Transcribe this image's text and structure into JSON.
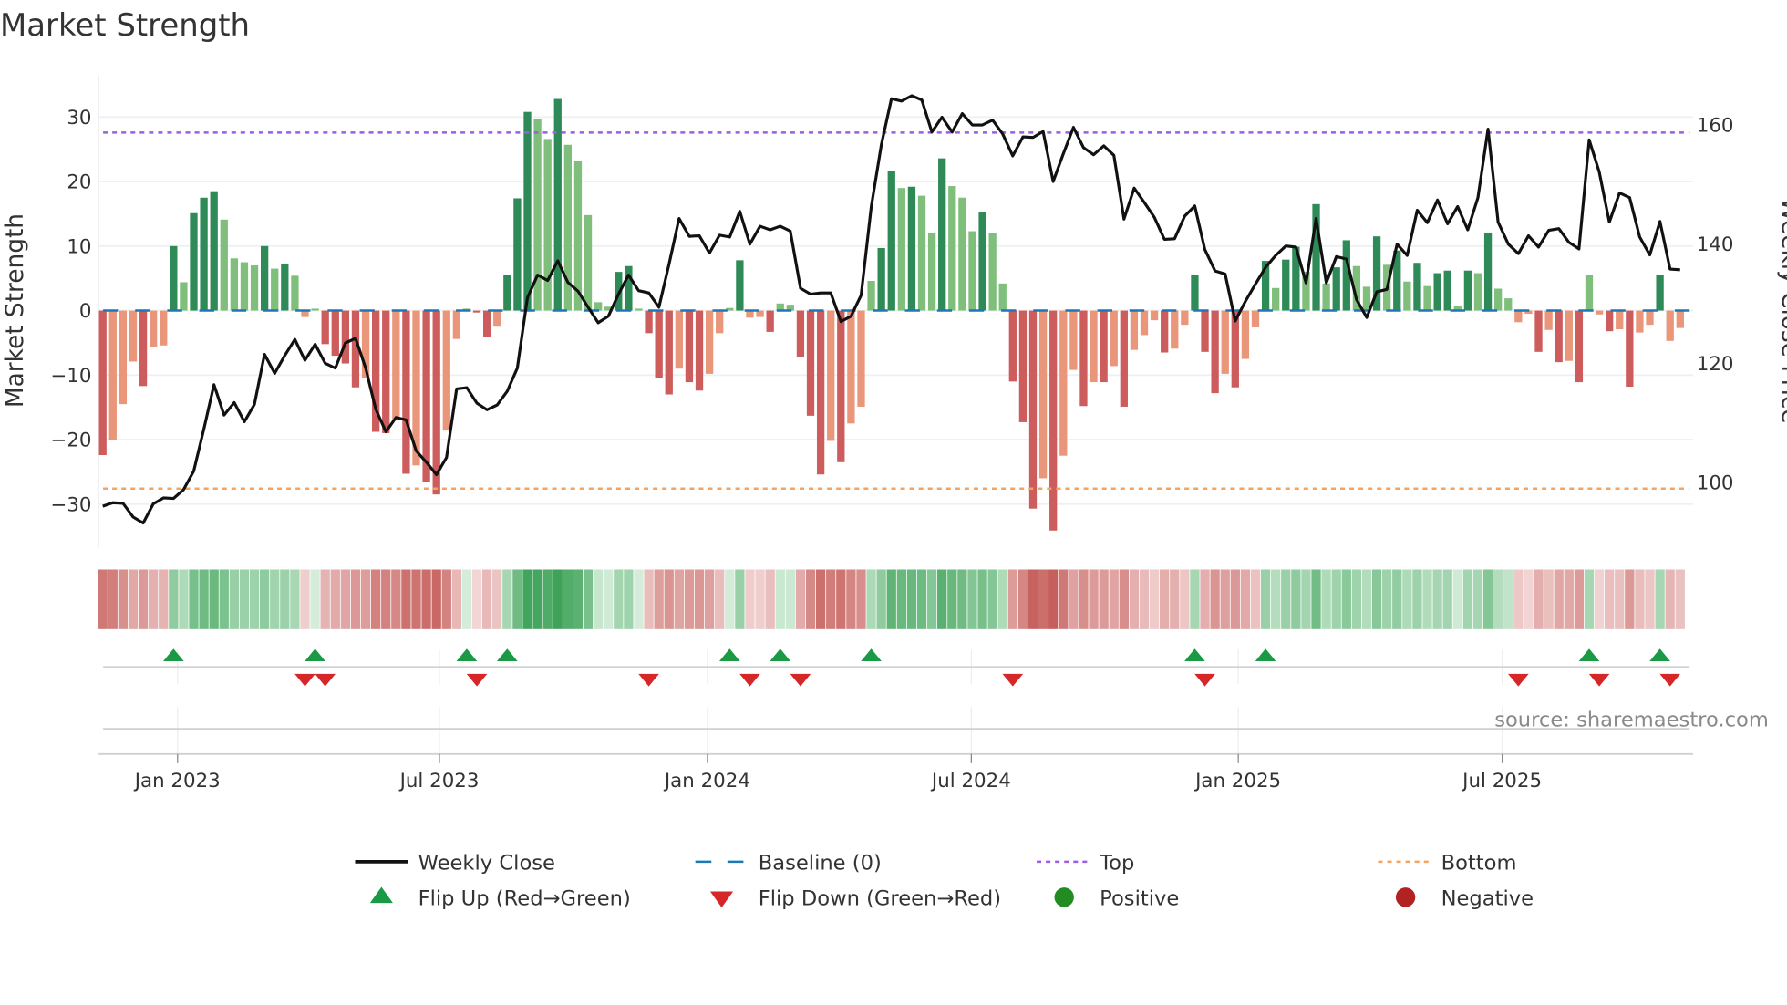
{
  "chart_data": {
    "type": "bar",
    "title": "Market Strength",
    "ylabel": "Market Strength",
    "y2label": "Weekly Close Price",
    "ylim": [
      -36.7,
      36.7
    ],
    "y2lim": [
      89,
      168.5
    ],
    "yticks": [
      30,
      20,
      10,
      0,
      -10,
      -20,
      -30
    ],
    "yticklabels": [
      "30",
      "20",
      "10",
      "0",
      "−10",
      "−20",
      "−30"
    ],
    "y2ticks": [
      160,
      140,
      120,
      100
    ],
    "y2ticklabels": [
      "160",
      "140",
      "120",
      "100"
    ],
    "top_level": 27.6,
    "bottom_level": -27.6,
    "baseline": 0,
    "grid": true,
    "xticks": [
      {
        "week": 7.4,
        "label": "Jan 2023"
      },
      {
        "week": 33.3,
        "label": "Jul 2023"
      },
      {
        "week": 59.8,
        "label": "Jan 2024"
      },
      {
        "week": 85.9,
        "label": "Jul 2024"
      },
      {
        "week": 112.3,
        "label": "Jan 2025"
      },
      {
        "week": 138.4,
        "label": "Jul 2025"
      }
    ],
    "series": [
      {
        "name": "Market Strength",
        "type": "bar",
        "values": [
          -22.4,
          -20,
          -14.5,
          -7.9,
          -11.7,
          -5.7,
          -5.4,
          10,
          4.4,
          15.1,
          17.5,
          18.5,
          14.1,
          8.1,
          7.5,
          7,
          10,
          6.5,
          7.3,
          5.4,
          -1,
          0.3,
          -5.2,
          -7,
          -8.2,
          -11.9,
          -10.5,
          -18.8,
          -19,
          -17,
          -25.3,
          -24,
          -26.5,
          -28.5,
          -18.6,
          -4.4,
          0.3,
          -0.3,
          -4.1,
          -2.5,
          5.5,
          17.4,
          30.8,
          29.7,
          26.6,
          32.8,
          25.7,
          23.2,
          14.8,
          1.3,
          0.6,
          6,
          6.9,
          0.3,
          -3.5,
          -10.4,
          -13,
          -9,
          -11.1,
          -12.4,
          -9.8,
          -3.5,
          0.4,
          7.8,
          -1.1,
          -1,
          -3.3,
          1.1,
          0.9,
          -7.2,
          -16.3,
          -25.4,
          -20.2,
          -23.5,
          -17.5,
          -14.9,
          4.6,
          9.7,
          21.6,
          19,
          19.2,
          17.8,
          12.1,
          23.6,
          19.3,
          17.5,
          12.3,
          15.2,
          12,
          4.2,
          -11,
          -17.3,
          -30.7,
          -26,
          -34.1,
          -22.5,
          -9.2,
          -14.8,
          -11.1,
          -11.1,
          -8.6,
          -14.9,
          -6.1,
          -3.8,
          -1.5,
          -6.5,
          -5.9,
          -2.2,
          5.5,
          -6.4,
          -12.8,
          -9.8,
          -11.9,
          -7.5,
          -2.6,
          7.7,
          3.5,
          7.9,
          9.9,
          6,
          16.5,
          4.2,
          6.7,
          10.9,
          6.9,
          3.7,
          11.5,
          7.1,
          9.3,
          4.5,
          7.4,
          3.8,
          5.8,
          6.2,
          0.7,
          6.2,
          5.8,
          12.1,
          3.4,
          1.9,
          -1.8,
          -0.5,
          -6.4,
          -3,
          -8,
          -7.8,
          -11.1,
          5.5,
          -0.6,
          -3.2,
          -2.9,
          -11.8,
          -3.4,
          -2.2,
          5.5,
          -4.7,
          -2.7
        ]
      },
      {
        "name": "Weekly Close",
        "type": "line",
        "axis": "right",
        "values": [
          96.0,
          96.6,
          96.5,
          94.2,
          93.2,
          96.4,
          97.4,
          97.3,
          98.8,
          101.9,
          109,
          116.4,
          111.3,
          113.4,
          110.2,
          113.1,
          121.5,
          118.3,
          121.3,
          124,
          120.5,
          123.2,
          120,
          119.2,
          123.4,
          124.2,
          119.2,
          112.3,
          108.5,
          110.9,
          110.5,
          105.3,
          103.4,
          101.3,
          104.2,
          115.7,
          115.9,
          113.3,
          112.2,
          113,
          115.3,
          119.2,
          131,
          134.8,
          133.9,
          137.2,
          133.6,
          132.1,
          129.4,
          126.8,
          127.9,
          131.6,
          134.8,
          132.2,
          131.8,
          129.4,
          136.6,
          144.3,
          141.3,
          141.4,
          138.5,
          141.5,
          141.2,
          145.5,
          140,
          143,
          142.4,
          143,
          142.2,
          132.6,
          131.6,
          131.8,
          131.8,
          127,
          127.9,
          131.4,
          146.3,
          156.7,
          164.4,
          164,
          164.9,
          164.2,
          158.8,
          161.3,
          158.8,
          161.9,
          160,
          160,
          160.8,
          158.5,
          154.8,
          158,
          157.9,
          158.9,
          150.5,
          155.2,
          159.6,
          156.2,
          155,
          156.5,
          154.9,
          144.2,
          149.4,
          147,
          144.5,
          140.8,
          140.9,
          144.7,
          146.4,
          139.1,
          135.5,
          135,
          127.1,
          130.4,
          133.3,
          136.1,
          138.1,
          139.7,
          139.5,
          133.5,
          144.3,
          133.5,
          137.9,
          137.5,
          130.7,
          127.7,
          132,
          132.4,
          140,
          138.1,
          145.7,
          143.6,
          147.4,
          143.4,
          146.3,
          142.4,
          147.8,
          159.3,
          143.7,
          140,
          138.4,
          141.4,
          139.5,
          142.3,
          142.6,
          140.3,
          139.2,
          157.5,
          152.1,
          143.7,
          148.6,
          147.8,
          141.2,
          138.2,
          143.8,
          135.8,
          135.7
        ]
      }
    ],
    "legend": {
      "placement": "bottom",
      "items": [
        {
          "label": "Weekly Close",
          "symbol": "line"
        },
        {
          "label": "Baseline (0)",
          "symbol": "dash"
        },
        {
          "label": "Top",
          "symbol": "dot-purple"
        },
        {
          "label": "Bottom",
          "symbol": "dot-orange"
        },
        {
          "label": "Flip Up (Red→Green)",
          "symbol": "triangle-up"
        },
        {
          "label": "Flip Down (Green→Red)",
          "symbol": "triangle-down"
        },
        {
          "label": "Positive",
          "symbol": "circle-green"
        },
        {
          "label": "Negative",
          "symbol": "circle-red"
        }
      ]
    },
    "source": "source: sharemaestro.com"
  },
  "colors": {
    "pos_strong": "#2e8b57",
    "pos_weak": "#7fbf7b",
    "neg_strong": "#cd5c5c",
    "neg_weak": "#e9967a",
    "baseline": "#1f77b4",
    "top": "#9b5fe0",
    "bottom": "#f4a460",
    "flip_up": "#1a9a45",
    "flip_down": "#d62728",
    "positive": "#228b22",
    "negative": "#b22222"
  }
}
